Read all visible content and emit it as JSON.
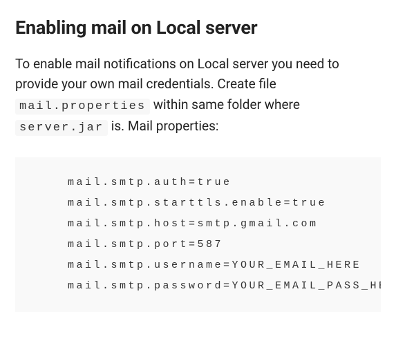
{
  "heading": "Enabling mail on Local server",
  "description": {
    "part1": "To enable mail notifications on Local server you need to provide your own mail credentials. Create file ",
    "code1": "mail.properties",
    "part2": " within same folder where ",
    "code2": "server.jar",
    "part3": " is. Mail properties:"
  },
  "code_lines": [
    "mail.smtp.auth=true",
    "mail.smtp.starttls.enable=true",
    "mail.smtp.host=smtp.gmail.com",
    "mail.smtp.port=587",
    "mail.smtp.username=YOUR_EMAIL_HERE",
    "mail.smtp.password=YOUR_EMAIL_PASS_HERE"
  ]
}
